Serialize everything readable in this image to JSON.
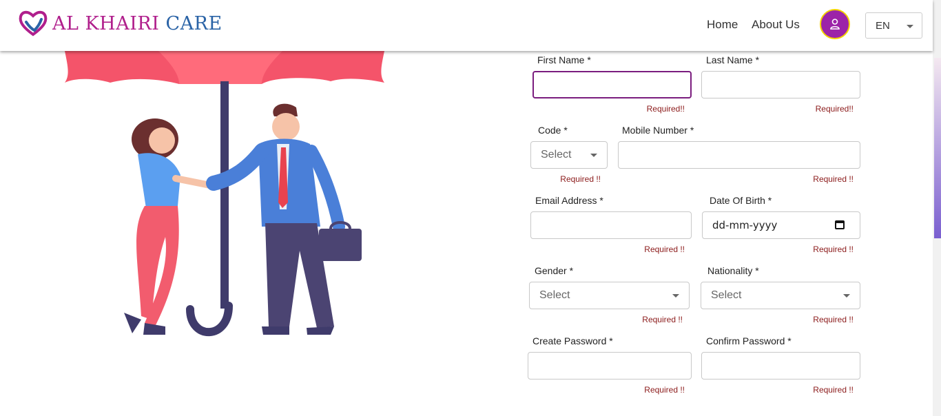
{
  "brand": {
    "part1": "AL KHAIRI",
    "part2": "CARE"
  },
  "nav": {
    "home": "Home",
    "about": "About Us"
  },
  "language": {
    "selected": "EN"
  },
  "form": {
    "first_name": {
      "label": "First Name *",
      "value": "",
      "error": "Required!!"
    },
    "last_name": {
      "label": "Last Name *",
      "value": "",
      "error": "Required!!"
    },
    "code": {
      "label": "Code *",
      "selected": "Select",
      "error": "Required !!"
    },
    "mobile": {
      "label": "Mobile Number *",
      "value": "",
      "error": "Required !!"
    },
    "email": {
      "label": "Email Address *",
      "value": "",
      "error": "Required !!"
    },
    "dob": {
      "label": "Date Of Birth *",
      "placeholder": "dd-mm-yyyy",
      "error": "Required !!"
    },
    "gender": {
      "label": "Gender *",
      "selected": "Select",
      "error": "Required !!"
    },
    "nationality": {
      "label": "Nationality *",
      "selected": "Select",
      "error": "Required !!"
    },
    "password": {
      "label": "Create Password *",
      "value": "",
      "error": "Required !!"
    },
    "confirm_password": {
      "label": "Confirm Password *",
      "value": "",
      "error": "Required !!"
    }
  },
  "colors": {
    "brand_pink": "#b01f8c",
    "brand_blue": "#2a63a6",
    "avatar": "#9c23a8",
    "focus": "#7a1c7e",
    "error": "#8b1a1a"
  }
}
